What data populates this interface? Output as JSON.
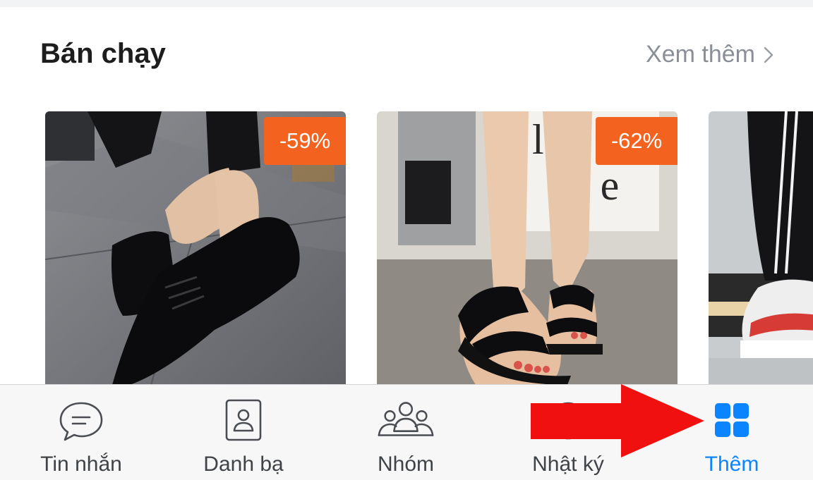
{
  "section": {
    "title": "Bán chạy",
    "see_more": "Xem thêm",
    "see_more_icon": "chevron-right-icon"
  },
  "products": [
    {
      "discount": "-59%",
      "image": "black-suede-lace-up-flat-shoes-photo"
    },
    {
      "discount": "-62%",
      "image": "black-strap-flip-flop-sandals-photo"
    },
    {
      "image": "white-red-sneakers-photo"
    }
  ],
  "bottom_nav": {
    "items": [
      {
        "label": "Tin nhắn",
        "icon": "chat-bubble-icon",
        "active": false
      },
      {
        "label": "Danh bạ",
        "icon": "contacts-icon",
        "active": false
      },
      {
        "label": "Nhóm",
        "icon": "group-icon",
        "active": false
      },
      {
        "label": "Nhật ký",
        "icon": "clock-icon",
        "active": false
      },
      {
        "label": "Thêm",
        "icon": "grid-icon",
        "active": true
      }
    ]
  },
  "annotation": {
    "icon": "red-arrow-icon",
    "color": "#f01010"
  },
  "colors": {
    "accent": "#0a84ff",
    "badge": "#f4621f",
    "nav_bg": "#f7f7f8"
  }
}
